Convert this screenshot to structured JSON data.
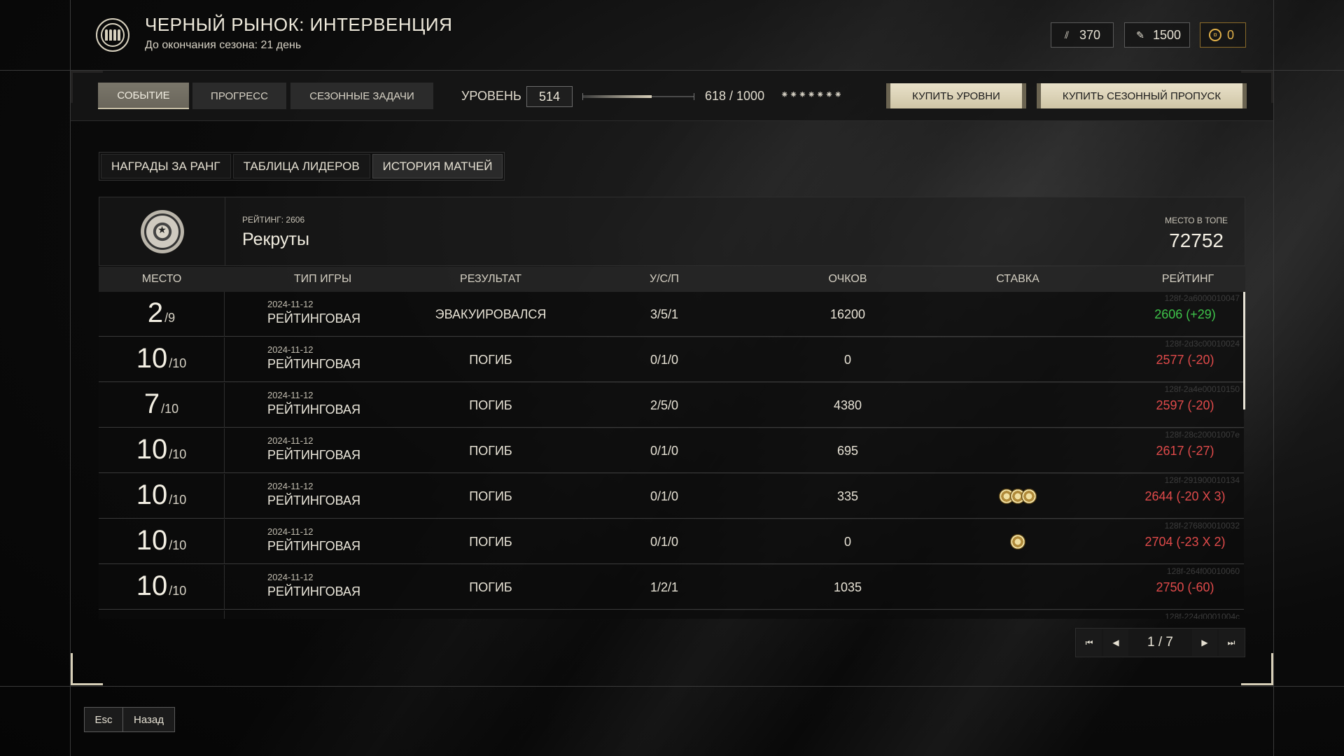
{
  "header": {
    "title": "ЧЕРНЫЙ РЫНОК: ИНТЕРВЕНЦИЯ",
    "subtitle": "До окончания сезона: 21 день",
    "currencies": [
      {
        "icon": "ammo-currency-icon",
        "value": "370"
      },
      {
        "icon": "ticket-currency-icon",
        "value": "1500"
      },
      {
        "icon": "coin-currency-icon",
        "value": "0",
        "color": "#e3b24a"
      }
    ]
  },
  "toolbar": {
    "tabs": [
      "СОБЫТИЕ",
      "ПРОГРЕСС",
      "СЕЗОННЫЕ ЗАДАЧИ"
    ],
    "active_tab": 0,
    "level_label": "УРОВЕНЬ",
    "level_value": "514",
    "xp_text": "618 / 1000",
    "xp_progress": 0.618,
    "stars": "⁕⁕⁕⁕⁕⁕⁕",
    "buy_levels": "КУПИТЬ УРОВНИ",
    "buy_pass": "КУПИТЬ СЕЗОННЫЙ ПРОПУСК"
  },
  "subtabs": {
    "items": [
      "НАГРАДЫ ЗА РАНГ",
      "ТАБЛИЦА ЛИДЕРОВ",
      "ИСТОРИЯ МАТЧЕЙ"
    ],
    "active": 2
  },
  "rank": {
    "rating_label": "РЕЙТИНГ: 2606",
    "name": "Рекруты",
    "top_label": "МЕСТО В ТОПЕ",
    "top_value": "72752"
  },
  "table": {
    "columns": [
      "МЕСТО",
      "ТИП ИГРЫ",
      "РЕЗУЛЬТАТ",
      "У/С/П",
      "ОЧКОВ",
      "СТАВКА",
      "РЕЙТИНГ"
    ],
    "rows": [
      {
        "place": "2",
        "of": "/9",
        "date": "2024-11-12",
        "type": "РЕЙТИНГОВАЯ",
        "result": "ЭВАКУИРОВАЛСЯ",
        "ksa": "3/5/1",
        "points": "16200",
        "bet": 0,
        "rating": "2606 (+29)",
        "positive": true,
        "id": "128f-2a6000010047"
      },
      {
        "place": "10",
        "of": "/10",
        "date": "2024-11-12",
        "type": "РЕЙТИНГОВАЯ",
        "result": "ПОГИБ",
        "ksa": "0/1/0",
        "points": "0",
        "bet": 0,
        "rating": "2577 (-20)",
        "positive": false,
        "id": "128f-2d3c00010024"
      },
      {
        "place": "7",
        "of": "/10",
        "date": "2024-11-12",
        "type": "РЕЙТИНГОВАЯ",
        "result": "ПОГИБ",
        "ksa": "2/5/0",
        "points": "4380",
        "bet": 0,
        "rating": "2597 (-20)",
        "positive": false,
        "id": "128f-2a4e00010150"
      },
      {
        "place": "10",
        "of": "/10",
        "date": "2024-11-12",
        "type": "РЕЙТИНГОВАЯ",
        "result": "ПОГИБ",
        "ksa": "0/1/0",
        "points": "695",
        "bet": 0,
        "rating": "2617 (-27)",
        "positive": false,
        "id": "128f-28c20001007e"
      },
      {
        "place": "10",
        "of": "/10",
        "date": "2024-11-12",
        "type": "РЕЙТИНГОВАЯ",
        "result": "ПОГИБ",
        "ksa": "0/1/0",
        "points": "335",
        "bet": 3,
        "rating": "2644 (-20 X 3)",
        "positive": false,
        "id": "128f-291900010134"
      },
      {
        "place": "10",
        "of": "/10",
        "date": "2024-11-12",
        "type": "РЕЙТИНГОВАЯ",
        "result": "ПОГИБ",
        "ksa": "0/1/0",
        "points": "0",
        "bet": 1,
        "rating": "2704 (-23 X 2)",
        "positive": false,
        "id": "128f-276800010032"
      },
      {
        "place": "10",
        "of": "/10",
        "date": "2024-11-12",
        "type": "РЕЙТИНГОВАЯ",
        "result": "ПОГИБ",
        "ksa": "1/2/1",
        "points": "1035",
        "bet": 0,
        "rating": "2750 (-60)",
        "positive": false,
        "id": "128f-264f00010060"
      },
      {
        "place": "",
        "of": "",
        "date": "",
        "type": "",
        "result": "",
        "ksa": "",
        "points": "",
        "bet": 0,
        "rating": "",
        "positive": false,
        "id": "128f-224d0001004c"
      }
    ]
  },
  "pager": {
    "text": "1 / 7"
  },
  "footer": {
    "key": "Esc",
    "label": "Назад"
  }
}
